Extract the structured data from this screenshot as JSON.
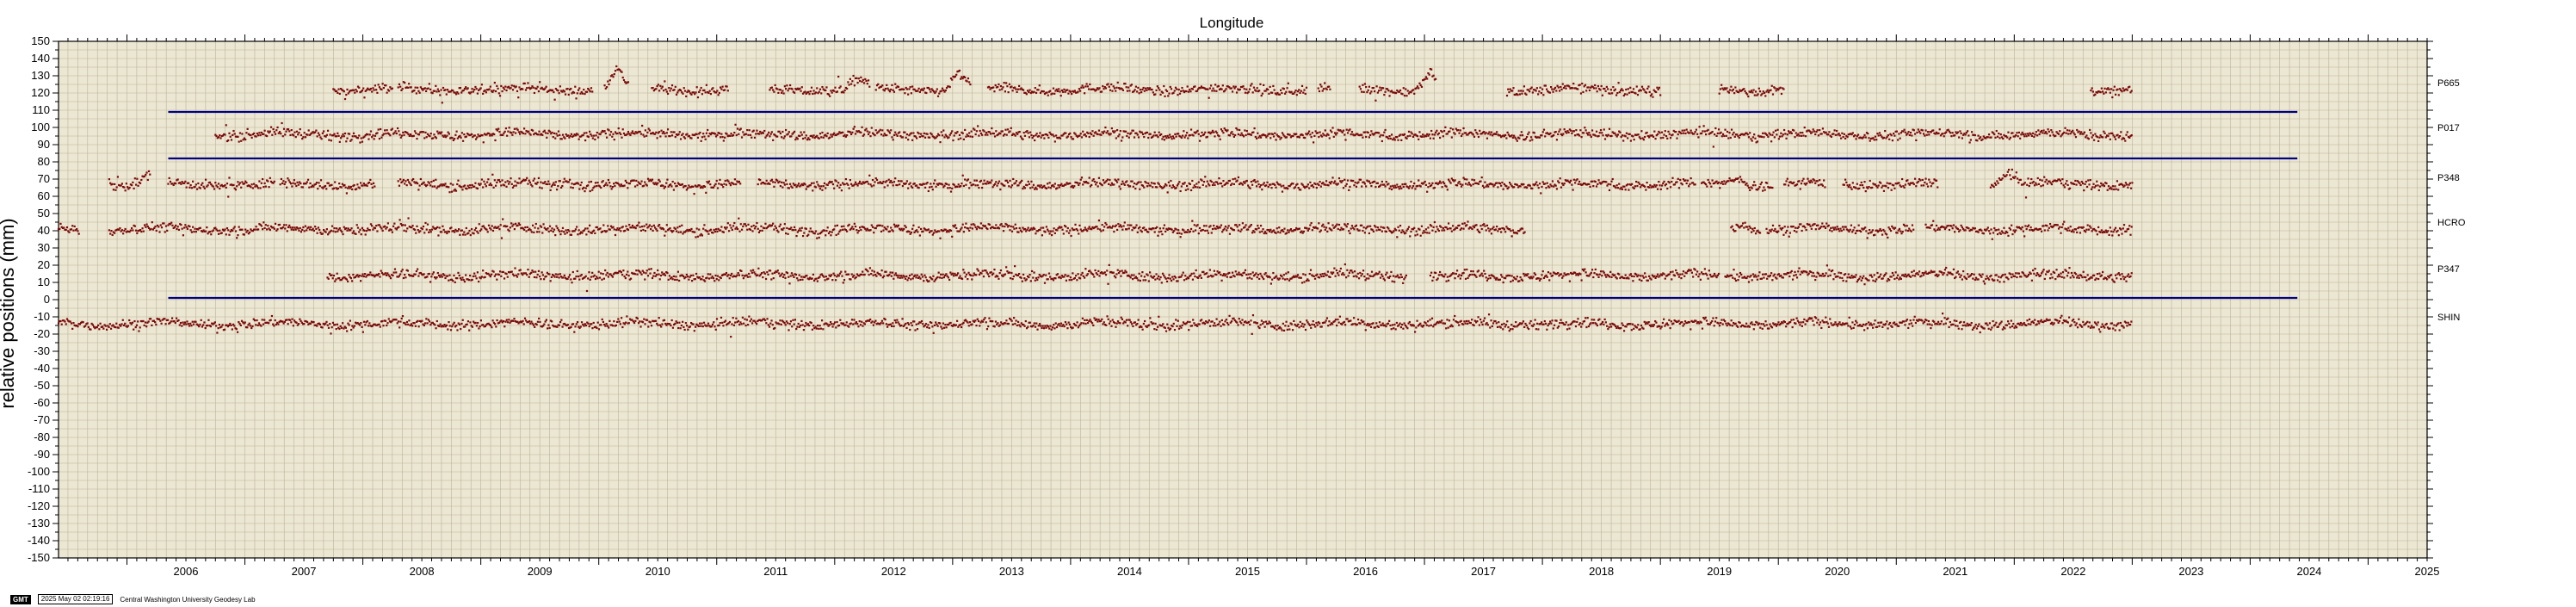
{
  "chart_data": {
    "type": "scatter",
    "title": "Longitude",
    "xlabel": "",
    "ylabel": "relative positions (mm)",
    "xlim": [
      2005.42,
      2025.5
    ],
    "ylim": [
      -150,
      150
    ],
    "y_ticks": [
      150,
      140,
      130,
      120,
      110,
      100,
      90,
      80,
      70,
      60,
      50,
      40,
      30,
      20,
      10,
      0,
      -10,
      -20,
      -30,
      -40,
      -50,
      -60,
      -70,
      -80,
      -90,
      -100,
      -110,
      -120,
      -130,
      -140,
      -150
    ],
    "x_tick_labels": [
      "2006",
      "2007",
      "2008",
      "2009",
      "2010",
      "2011",
      "2012",
      "2013",
      "2014",
      "2015",
      "2016",
      "2017",
      "2018",
      "2019",
      "2020",
      "2021",
      "2022",
      "2023",
      "2024",
      "2025"
    ],
    "grid": true,
    "background": "#ece7d2",
    "point_color": "#7a0a0a",
    "model_line_color": "#000080",
    "series": [
      {
        "name": "P665",
        "baseline": 122,
        "segments": [
          [
            2007.75,
            2008.25
          ],
          [
            2008.3,
            2009.95
          ],
          [
            2010.05,
            2010.25
          ],
          [
            2010.45,
            2011.1
          ],
          [
            2011.45,
            2012.3
          ],
          [
            2012.35,
            2013.15
          ],
          [
            2013.3,
            2016.0
          ],
          [
            2016.1,
            2016.2
          ],
          [
            2016.45,
            2017.1
          ],
          [
            2017.7,
            2019.0
          ],
          [
            2019.5,
            2020.05
          ],
          [
            2022.65,
            2023.0
          ]
        ],
        "events": [
          {
            "x": 2010.15,
            "dy": 12
          },
          {
            "x": 2013.05,
            "dy": 10
          },
          {
            "x": 2012.2,
            "dy": 6
          },
          {
            "x": 2017.05,
            "dy": 10
          }
        ]
      },
      {
        "name": "P017",
        "baseline": 96,
        "segments": [
          [
            2006.75,
            2023.0
          ]
        ],
        "events": []
      },
      {
        "name": "P348",
        "baseline": 67,
        "segments": [
          [
            2005.85,
            2006.2
          ],
          [
            2006.35,
            2007.25
          ],
          [
            2007.3,
            2008.1
          ],
          [
            2008.3,
            2011.2
          ],
          [
            2011.35,
            2019.3
          ],
          [
            2019.35,
            2019.95
          ],
          [
            2020.05,
            2020.4
          ],
          [
            2020.55,
            2021.35
          ],
          [
            2021.8,
            2023.0
          ]
        ],
        "events": [
          {
            "x": 2006.2,
            "dy": 6
          },
          {
            "x": 2009.75,
            "dy": 4
          },
          {
            "x": 2019.65,
            "dy": 4
          },
          {
            "x": 2021.95,
            "dy": 8
          }
        ]
      },
      {
        "name": "HCRO",
        "baseline": 41,
        "segments": [
          [
            2005.42,
            2005.6
          ],
          [
            2005.85,
            2017.85
          ],
          [
            2019.6,
            2019.85
          ],
          [
            2019.9,
            2021.15
          ],
          [
            2021.25,
            2023.0
          ]
        ],
        "events": [
          {
            "x": 2019.7,
            "dy": 4
          }
        ]
      },
      {
        "name": "P347",
        "baseline": 14,
        "segments": [
          [
            2007.7,
            2016.85
          ],
          [
            2017.05,
            2019.5
          ],
          [
            2019.55,
            2023.0
          ]
        ],
        "events": []
      },
      {
        "name": "SHIN",
        "baseline": -14,
        "segments": [
          [
            2005.42,
            2023.0
          ]
        ],
        "events": []
      }
    ],
    "model_lines": [
      {
        "y": 109,
        "x": [
          2006.35,
          2024.4
        ]
      },
      {
        "y": 82,
        "x": [
          2006.35,
          2024.4
        ]
      },
      {
        "y": 1,
        "x": [
          2006.35,
          2024.4
        ]
      }
    ]
  },
  "footer": {
    "logo": "GMT",
    "timestamp": "2025 May 02 02:19:16",
    "credit": "Central Washington University Geodesy Lab"
  }
}
